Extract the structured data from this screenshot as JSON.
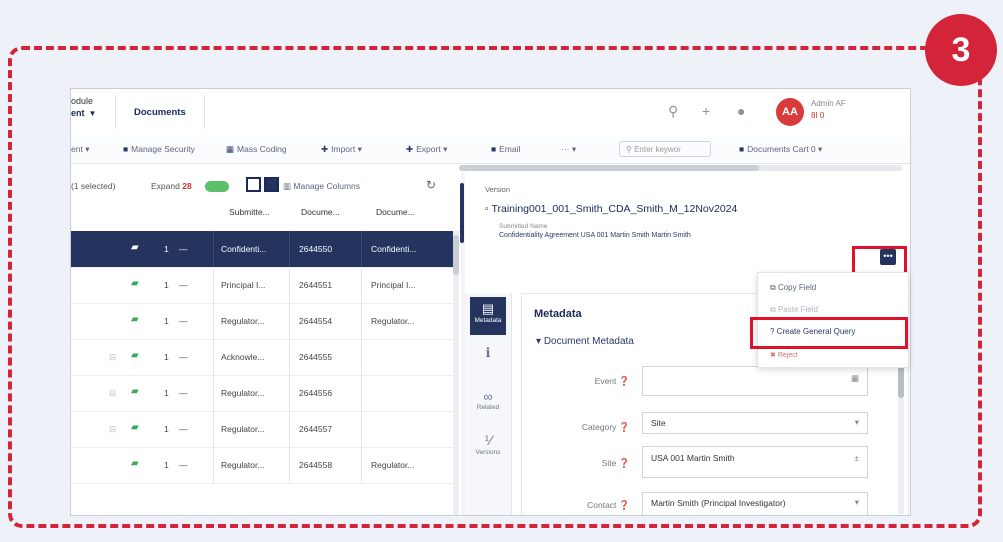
{
  "step_badge": "3",
  "topbar": {
    "module_line1": "odule",
    "module_line2": "ent",
    "tab_label": "Documents",
    "avatar": "AA",
    "user_name": "Admin AF",
    "user_sub": "8I 0"
  },
  "toolbar": {
    "items": [
      "ent",
      "Manage Security",
      "Mass Coding",
      "Import",
      "Export",
      "Email",
      "···"
    ],
    "search_placeholder": "Enter keywor",
    "cart": "Documents Cart 0"
  },
  "grid": {
    "selected_text": "(1 selected)",
    "expand_label": "Expand",
    "expand_count": "28",
    "manage_columns": "Manage Columns",
    "columns": [
      "Submitte...",
      "Docume...",
      "Docume..."
    ],
    "rows": [
      {
        "num": "1",
        "submitted": "Confidenti...",
        "doc_id": "2644550",
        "doc_type": "Confidenti...",
        "active": true
      },
      {
        "num": "1",
        "submitted": "Principal I...",
        "doc_id": "2644551",
        "doc_type": "Principal I..."
      },
      {
        "num": "1",
        "submitted": "Regulator...",
        "doc_id": "2644554",
        "doc_type": "Regulator..."
      },
      {
        "num": "1",
        "submitted": "Acknowle...",
        "doc_id": "2644555",
        "doc_type": ""
      },
      {
        "num": "1",
        "submitted": "Regulator...",
        "doc_id": "2644556",
        "doc_type": ""
      },
      {
        "num": "1",
        "submitted": "Regulator...",
        "doc_id": "2644557",
        "doc_type": ""
      },
      {
        "num": "1",
        "submitted": "Regulator...",
        "doc_id": "2644558",
        "doc_type": "Regulator..."
      }
    ]
  },
  "detail": {
    "version": "Version",
    "file_name": "Training001_001_Smith_CDA_Smith_M_12Nov2024",
    "submitted_name_label": "Submitted Name",
    "submitted_name": "Confidentiality Agreement USA 001 Martin Smith Martin Smith",
    "side_tabs": [
      "Metadata",
      "",
      "Related",
      "Versions"
    ],
    "meta_title": "Metadata",
    "meta_section": "Document Metadata",
    "fields": [
      {
        "label": "Event",
        "value": ""
      },
      {
        "label": "Category",
        "value": "Site"
      },
      {
        "label": "Site",
        "value": "USA 001 Martin Smith"
      },
      {
        "label": "Contact",
        "value": "Martin Smith (Principal Investigator)"
      }
    ]
  },
  "menu": {
    "copy_field": "Copy Field",
    "paste_field": "Paste Field",
    "create_general_query": "Create General Query",
    "reject": "Reject"
  },
  "colors": {
    "accent": "#d3243a",
    "navy": "#24345e",
    "highlight": "#e0112d"
  }
}
